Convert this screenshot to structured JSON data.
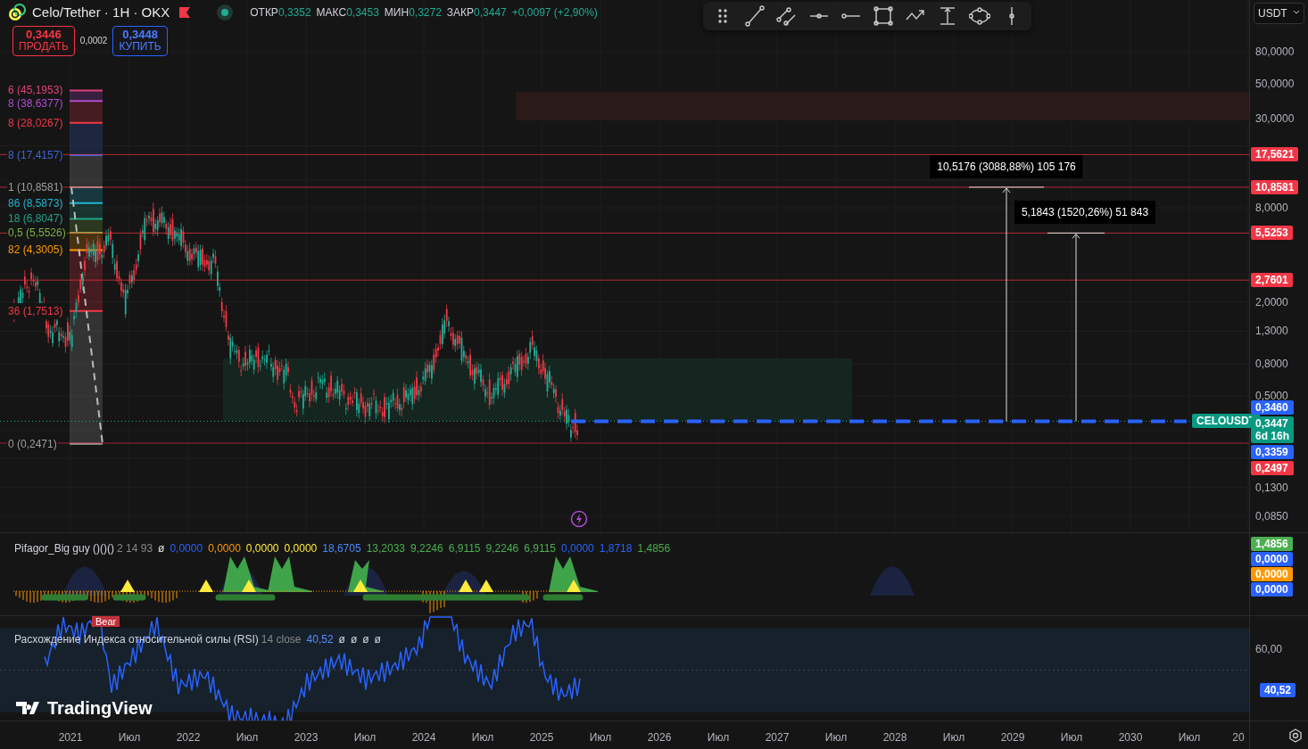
{
  "header": {
    "title": "Celo/Tether · 1H · OKX",
    "ohlc": [
      {
        "label": "ОТКР",
        "value": "0,3352"
      },
      {
        "label": "МАКС",
        "value": "0,3453"
      },
      {
        "label": "МИН",
        "value": "0,3272"
      },
      {
        "label": "ЗАКР",
        "value": "0,3447"
      }
    ],
    "change": "+0,0097 (+2,90%)"
  },
  "trade": {
    "sell": {
      "price": "0,3446",
      "label": "ПРОДАТЬ"
    },
    "spread": "0,0002",
    "buy": {
      "price": "0,3448",
      "label": "КУПИТЬ"
    }
  },
  "currency": "USDT",
  "fib_levels": [
    {
      "label": "6 (45,1953)",
      "color": "#e0407a"
    },
    {
      "label": "8 (38,6377)",
      "color": "#b04cd0"
    },
    {
      "label": "8 (28,0267)",
      "color": "#f23645"
    },
    {
      "label": "8 (17,4157)",
      "color": "#3f62d6"
    },
    {
      "label": "1 (10,8581)",
      "color": "#9e9e9e"
    },
    {
      "label": "86 (8,5873)",
      "color": "#22b5d0"
    },
    {
      "label": "18 (6,8047)",
      "color": "#1fa38a"
    },
    {
      "label": "0,5 (5,5526)",
      "color": "#7cb342"
    },
    {
      "label": "82 (4,3005)",
      "color": "#ff9800"
    },
    {
      "label": "36 (1,7513)",
      "color": "#f23645"
    },
    {
      "label": "0 (0,2471)",
      "color": "#9e9e9e"
    }
  ],
  "measures": [
    {
      "label": "10,5176 (3088,88%) 105 176"
    },
    {
      "label": "5,1843 (1520,26%) 51 843"
    }
  ],
  "symbol_tag": "CELOUSDT",
  "price_axis": {
    "ticks": [
      "80,0000",
      "50,0000",
      "30,0000",
      "8,0000",
      "2,0000",
      "1,3000",
      "0,8000",
      "0,5000",
      "0,1300",
      "0,0850"
    ],
    "level_tags": [
      {
        "value": "17,5621",
        "color": "#f23645"
      },
      {
        "value": "10,8581",
        "color": "#f23645"
      },
      {
        "value": "5,5253",
        "color": "#f23645"
      },
      {
        "value": "2,7601",
        "color": "#f23645"
      }
    ],
    "price_stack": [
      {
        "value": "0,3460",
        "color": "#2962ff"
      },
      {
        "value": "0,3447",
        "extra": "6d 16h",
        "color": "#089981"
      },
      {
        "value": "0,3359",
        "color": "#2962ff"
      },
      {
        "value": "0,2497",
        "color": "#f23645"
      }
    ]
  },
  "indicator": {
    "name": "Pifagor_Big guy ()()()",
    "params": "2 14 93",
    "values": [
      {
        "text": "ø",
        "color": "#e0e0e0"
      },
      {
        "text": "0,0000",
        "color": "#2962ff"
      },
      {
        "text": "0,0000",
        "color": "#ff9800"
      },
      {
        "text": "0,0000",
        "color": "#ffeb3b"
      },
      {
        "text": "0,0000",
        "color": "#ffeb3b"
      },
      {
        "text": "18,6705",
        "color": "#448aff"
      },
      {
        "text": "13,2033",
        "color": "#4caf50"
      },
      {
        "text": "9,2246",
        "color": "#4caf50"
      },
      {
        "text": "6,9115",
        "color": "#4caf50"
      },
      {
        "text": "9,2246",
        "color": "#4caf50"
      },
      {
        "text": "6,9115",
        "color": "#4caf50"
      },
      {
        "text": "0,0000",
        "color": "#2962ff"
      },
      {
        "text": "1,8718",
        "color": "#2962ff"
      },
      {
        "text": "1,4856",
        "color": "#4caf50"
      }
    ],
    "axis_tags": [
      {
        "value": "1,4856",
        "color": "#4caf50"
      },
      {
        "value": "0,0000",
        "color": "#2962ff"
      },
      {
        "value": "0,0000",
        "color": "#ff9800"
      },
      {
        "value": "0,0000",
        "color": "#2962ff"
      }
    ]
  },
  "rsi": {
    "name": "Расхождение Индекса относительной силы (RSI)",
    "params": "14 close",
    "value": "40,52",
    "extra": [
      "ø",
      "ø",
      "ø",
      "ø"
    ],
    "bear_label": "Bear",
    "axis_tick": "60,00",
    "value_tag": "40,52"
  },
  "logo": "TradingView",
  "time_axis": [
    "2021",
    "Июл",
    "2022",
    "Июл",
    "2023",
    "Июл",
    "2024",
    "Июл",
    "2025",
    "Июл",
    "2026",
    "Июл",
    "2027",
    "Июл",
    "2028",
    "Июл",
    "2029",
    "Июл",
    "2030",
    "Июл",
    "20"
  ]
}
